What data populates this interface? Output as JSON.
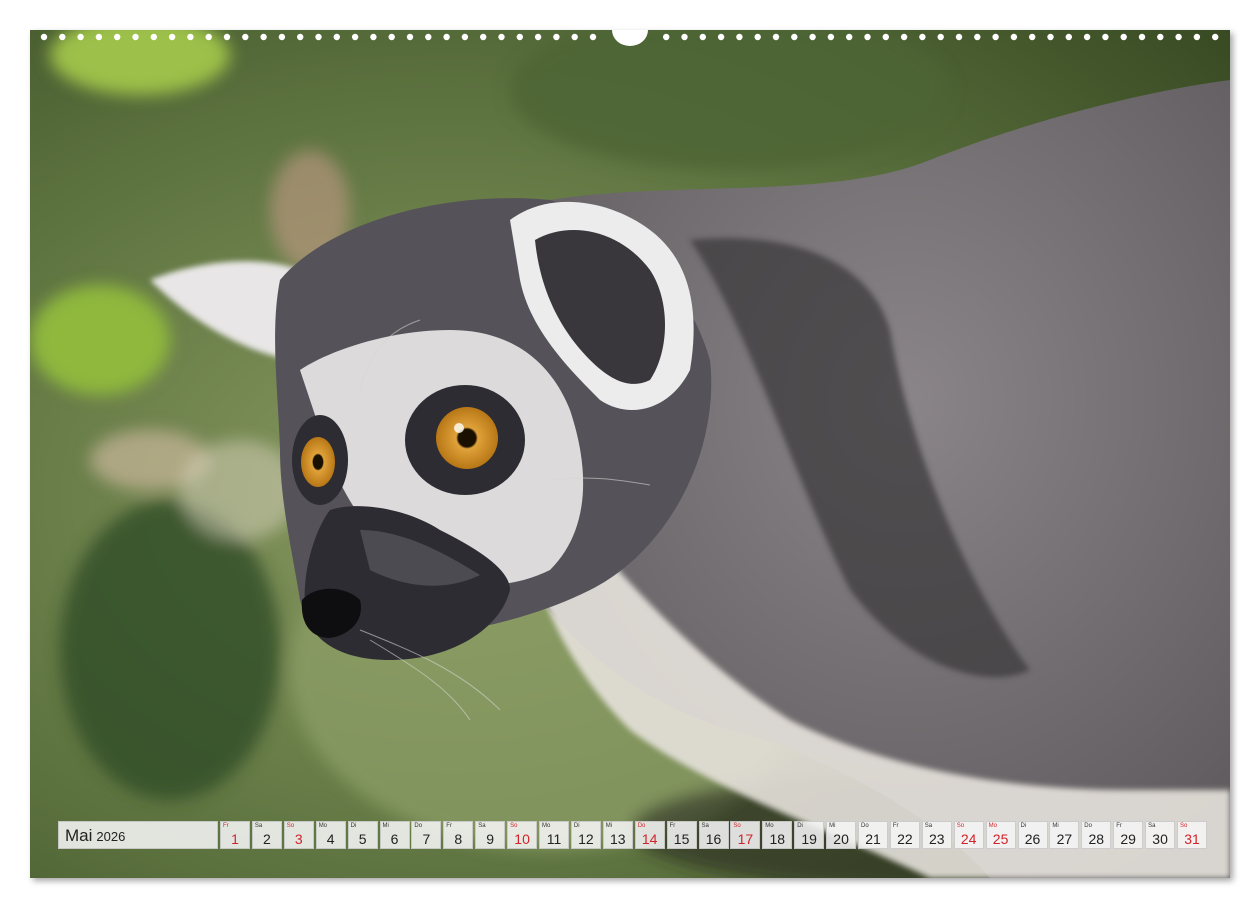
{
  "calendar": {
    "month": "Mai",
    "year": "2026",
    "days": [
      {
        "num": "1",
        "dow": "Fr",
        "red": true
      },
      {
        "num": "2",
        "dow": "Sa",
        "red": false
      },
      {
        "num": "3",
        "dow": "So",
        "red": true
      },
      {
        "num": "4",
        "dow": "Mo",
        "red": false
      },
      {
        "num": "5",
        "dow": "Di",
        "red": false
      },
      {
        "num": "6",
        "dow": "Mi",
        "red": false
      },
      {
        "num": "7",
        "dow": "Do",
        "red": false
      },
      {
        "num": "8",
        "dow": "Fr",
        "red": false
      },
      {
        "num": "9",
        "dow": "Sa",
        "red": false
      },
      {
        "num": "10",
        "dow": "So",
        "red": true
      },
      {
        "num": "11",
        "dow": "Mo",
        "red": false
      },
      {
        "num": "12",
        "dow": "Di",
        "red": false
      },
      {
        "num": "13",
        "dow": "Mi",
        "red": false
      },
      {
        "num": "14",
        "dow": "Do",
        "red": true
      },
      {
        "num": "15",
        "dow": "Fr",
        "red": false
      },
      {
        "num": "16",
        "dow": "Sa",
        "red": false
      },
      {
        "num": "17",
        "dow": "So",
        "red": true
      },
      {
        "num": "18",
        "dow": "Mo",
        "red": false
      },
      {
        "num": "19",
        "dow": "Di",
        "red": false
      },
      {
        "num": "20",
        "dow": "Mi",
        "red": false
      },
      {
        "num": "21",
        "dow": "Do",
        "red": false
      },
      {
        "num": "22",
        "dow": "Fr",
        "red": false
      },
      {
        "num": "23",
        "dow": "Sa",
        "red": false
      },
      {
        "num": "24",
        "dow": "So",
        "red": true
      },
      {
        "num": "25",
        "dow": "Mo",
        "red": true
      },
      {
        "num": "26",
        "dow": "Di",
        "red": false
      },
      {
        "num": "27",
        "dow": "Mi",
        "red": false
      },
      {
        "num": "28",
        "dow": "Do",
        "red": false
      },
      {
        "num": "29",
        "dow": "Fr",
        "red": false
      },
      {
        "num": "30",
        "dow": "Sa",
        "red": false
      },
      {
        "num": "31",
        "dow": "So",
        "red": true
      }
    ]
  },
  "colors": {
    "holiday_red": "#d0232a",
    "background_green": "#5f7a3a"
  }
}
